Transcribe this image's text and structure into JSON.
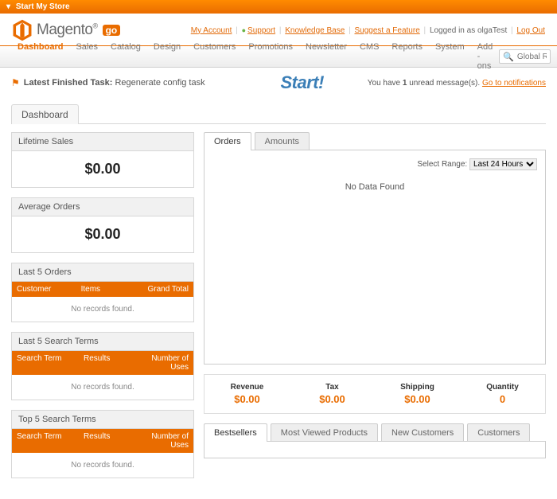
{
  "topbar": {
    "label": "Start My Store"
  },
  "brand": {
    "name": "Magento",
    "suffix": "go"
  },
  "headerLinks": {
    "myAccount": "My Account",
    "support": "Support",
    "knowledgeBase": "Knowledge Base",
    "suggestFeature": "Suggest a Feature",
    "loggedInAs": "Logged in as olgaTest",
    "logOut": "Log Out"
  },
  "nav": {
    "items": [
      "Dashboard",
      "Sales",
      "Catalog",
      "Design",
      "Customers",
      "Promotions",
      "Newsletter",
      "CMS",
      "Reports",
      "System",
      "Add - ons"
    ],
    "active": 0,
    "searchPlaceholder": "Global Record Search"
  },
  "msgbar": {
    "latestLabel": "Latest Finished Task:",
    "latestTask": "Regenerate config task",
    "startLabel": "Start!",
    "unreadPrefix": "You have ",
    "unreadCount": "1",
    "unreadSuffix": " unread message(s). ",
    "notifLink": "Go to notifications"
  },
  "pageTitle": "Dashboard",
  "left": {
    "lifetime": {
      "title": "Lifetime Sales",
      "value": "$0.00"
    },
    "average": {
      "title": "Average Orders",
      "value": "$0.00"
    },
    "last5orders": {
      "title": "Last 5 Orders",
      "cols": [
        "Customer",
        "Items",
        "Grand Total"
      ],
      "empty": "No records found."
    },
    "last5search": {
      "title": "Last 5 Search Terms",
      "cols": [
        "Search Term",
        "Results",
        "Number of Uses"
      ],
      "empty": "No records found."
    },
    "top5search": {
      "title": "Top 5 Search Terms",
      "cols": [
        "Search Term",
        "Results",
        "Number of Uses"
      ],
      "empty": "No records found."
    }
  },
  "right": {
    "chartTabs": [
      "Orders",
      "Amounts"
    ],
    "activeChartTab": 0,
    "rangeLabel": "Select Range:",
    "rangeOptions": [
      "Last 24 Hours"
    ],
    "noData": "No Data Found",
    "summary": [
      {
        "label": "Revenue",
        "value": "$0.00"
      },
      {
        "label": "Tax",
        "value": "$0.00"
      },
      {
        "label": "Shipping",
        "value": "$0.00"
      },
      {
        "label": "Quantity",
        "value": "0"
      }
    ],
    "bottomTabs": [
      "Bestsellers",
      "Most Viewed Products",
      "New Customers",
      "Customers"
    ],
    "bottomActive": 0
  }
}
